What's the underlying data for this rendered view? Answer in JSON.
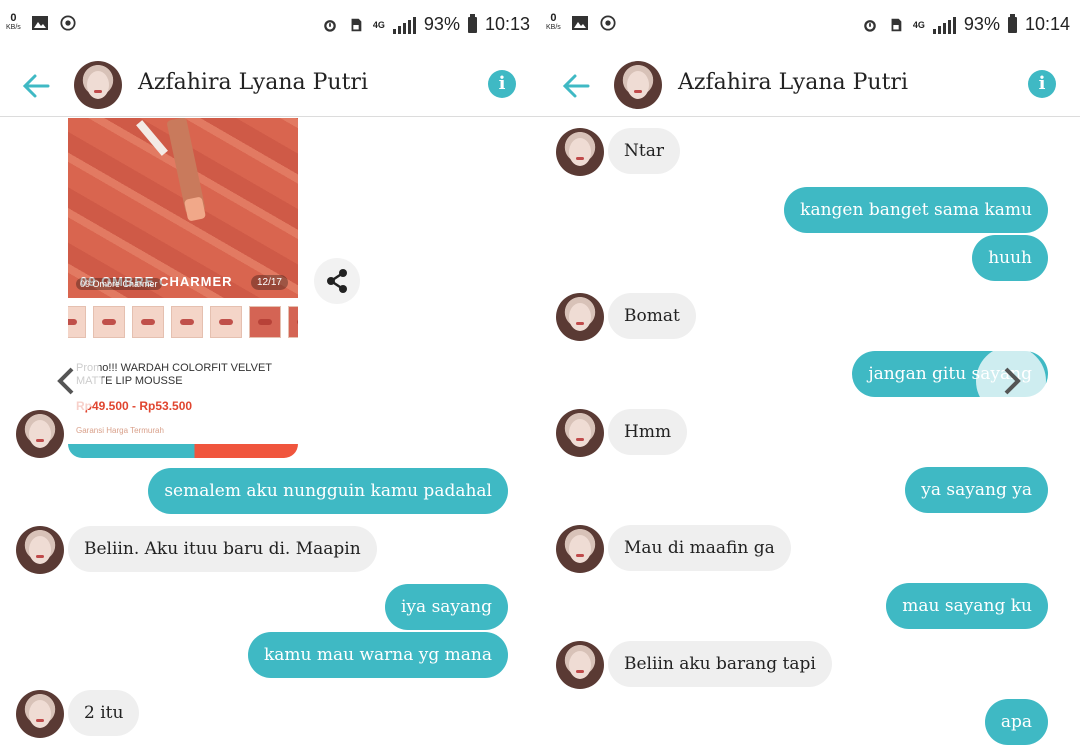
{
  "left": {
    "status": {
      "kb_value": "0",
      "kb_unit": "KB/s",
      "network": "4G",
      "battery": "93%",
      "time": "10:13"
    },
    "header": {
      "contact_name": "Azfahira Lyana Putri"
    },
    "product": {
      "shade_caption": "09 OMBRE CHARMER",
      "shade_sub": "09 Ombre Charmer",
      "counter": "12/17",
      "title": "Promo!!! WARDAH COLORFIT VELVET MATTE LIP MOUSSE",
      "price": "Rp49.500 - Rp53.500",
      "guarantee": "Garansi Harga Termurah"
    },
    "messages": [
      {
        "dir": "out",
        "text": "semalem aku nungguin kamu padahal"
      },
      {
        "dir": "in",
        "text": "Beliin. Aku ituu baru di. Maapin"
      },
      {
        "dir": "out",
        "text": "iya sayang"
      },
      {
        "dir": "out",
        "text": "kamu mau warna yg mana"
      },
      {
        "dir": "in",
        "text": "2 itu"
      }
    ]
  },
  "right": {
    "status": {
      "kb_value": "0",
      "kb_unit": "KB/s",
      "network": "4G",
      "battery": "93%",
      "time": "10:14"
    },
    "header": {
      "contact_name": "Azfahira Lyana Putri"
    },
    "messages": [
      {
        "dir": "in",
        "text": "Ntar"
      },
      {
        "dir": "out",
        "text": "kangen banget sama kamu"
      },
      {
        "dir": "out",
        "text": "huuh"
      },
      {
        "dir": "in",
        "text": "Bomat"
      },
      {
        "dir": "out",
        "text": "jangan gitu sayang"
      },
      {
        "dir": "in",
        "text": "Hmm"
      },
      {
        "dir": "out",
        "text": "ya sayang ya"
      },
      {
        "dir": "in",
        "text": "Mau di maafin ga"
      },
      {
        "dir": "out",
        "text": "mau sayang ku"
      },
      {
        "dir": "in",
        "text": "Beliin aku barang tapi"
      },
      {
        "dir": "out",
        "text": "apa"
      }
    ]
  },
  "colors": {
    "accent": "#3fb9c4",
    "incoming_bubble": "#efefef",
    "outgoing_text": "#ffffff"
  },
  "icons": [
    "back-arrow-icon",
    "info-icon",
    "share-icon",
    "chevron-left-icon",
    "chevron-right-icon",
    "alarm-icon",
    "sim-icon",
    "signal-icon",
    "battery-icon",
    "gallery-icon",
    "whatsapp-icon"
  ]
}
